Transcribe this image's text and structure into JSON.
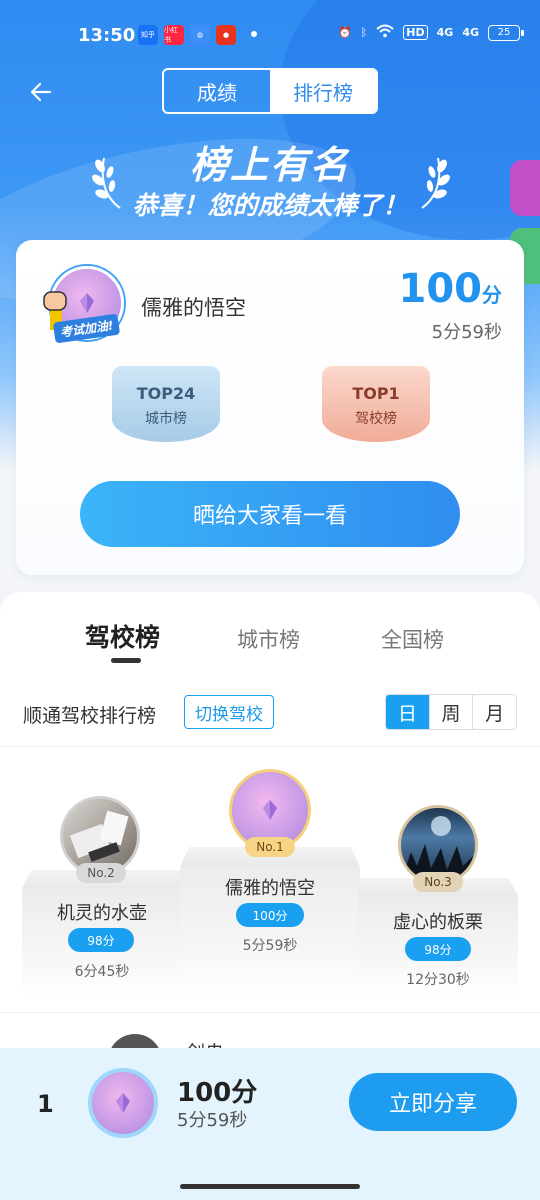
{
  "status_bar": {
    "time": "13:50",
    "apps": [
      {
        "name": "知乎",
        "color": "#1772f6"
      },
      {
        "name": "小红书",
        "color": "#ff2442"
      },
      {
        "name": "app",
        "color": "#3e8ef7"
      },
      {
        "name": "app",
        "color": "#e8341c"
      }
    ],
    "hd": "HD",
    "sig1": "4G",
    "sig2": "4G",
    "battery": "25"
  },
  "header": {
    "tab_score": "成绩",
    "tab_ranking": "排行榜",
    "banner_title": "榜上有名",
    "banner_sub": "恭喜！您的成绩太棒了！"
  },
  "card": {
    "cheer": "考试加油!",
    "username": "儒雅的悟空",
    "score": "100",
    "score_unit": "分",
    "time": "5分59秒",
    "badges": [
      {
        "top": "TOP24",
        "label": "城市榜"
      },
      {
        "top": "TOP1",
        "label": "驾校榜"
      }
    ],
    "share_button": "晒给大家看一看"
  },
  "ranking": {
    "tabs": [
      "驾校榜",
      "城市榜",
      "全国榜"
    ],
    "title": "顺通驾校排行榜",
    "switch_button": "切换驾校",
    "periods": [
      "日",
      "周",
      "月"
    ],
    "podium": [
      {
        "no": "No.2",
        "name": "机灵的水壶",
        "score": "98分",
        "time": "6分45秒"
      },
      {
        "no": "No.1",
        "name": "儒雅的悟空",
        "score": "100分",
        "time": "5分59秒"
      },
      {
        "no": "No.3",
        "name": "虚心的板栗",
        "score": "98分",
        "time": "12分30秒"
      }
    ],
    "row4_name": "剑央"
  },
  "bottom": {
    "rank": "1",
    "score": "100分",
    "time": "5分59秒",
    "share": "立即分享"
  },
  "colors": {
    "accent": "#1aa0f0",
    "hero": "#2f8bf0",
    "score": "#2192ee"
  }
}
